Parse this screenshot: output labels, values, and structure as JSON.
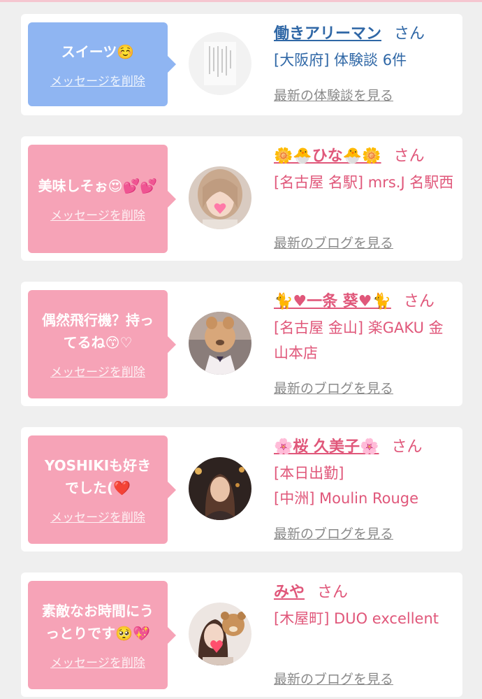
{
  "messages": [
    {
      "message": "スイーツ☺️",
      "delete_label": "メッセージを削除",
      "name": "働きアリーマン",
      "honorific": "さん",
      "details": [
        "[大阪府] 体験談 6件"
      ],
      "latest_link": "最新の体験談を見る",
      "color": "#8fb5f2"
    },
    {
      "message": "美味しそぉ😍💕💕",
      "delete_label": "メッセージを削除",
      "name": "🌼🐣ひな🐣🌼",
      "honorific": "さん",
      "details": [
        "[名古屋 名駅] mrs.J 名駅西"
      ],
      "latest_link": "最新のブログを見る",
      "color": "#f6a3b7"
    },
    {
      "message": "偶然飛行機？持ってるね😙♡",
      "delete_label": "メッセージを削除",
      "name": "🐈♥一条 葵♥🐈",
      "honorific": "さん",
      "details": [
        "[名古屋 金山] 楽GAKU 金山本店"
      ],
      "latest_link": "最新のブログを見る",
      "color": "#f6a3b7"
    },
    {
      "message": "YOSHIKIも好きでした(❤️",
      "delete_label": "メッセージを削除",
      "name": "🌸桜 久美子🌸",
      "honorific": "さん",
      "details": [
        "[本日出勤]",
        "[中洲] Moulin Rouge"
      ],
      "latest_link": "最新のブログを見る",
      "color": "#f6a3b7"
    },
    {
      "message": "素敵なお時間にうっとりです🥺💖",
      "delete_label": "メッセージを削除",
      "name": "みや",
      "honorific": "さん",
      "details": [
        "[木屋町] DUO excellent"
      ],
      "latest_link": "最新のブログを見る",
      "color": "#f6a3b7"
    }
  ]
}
